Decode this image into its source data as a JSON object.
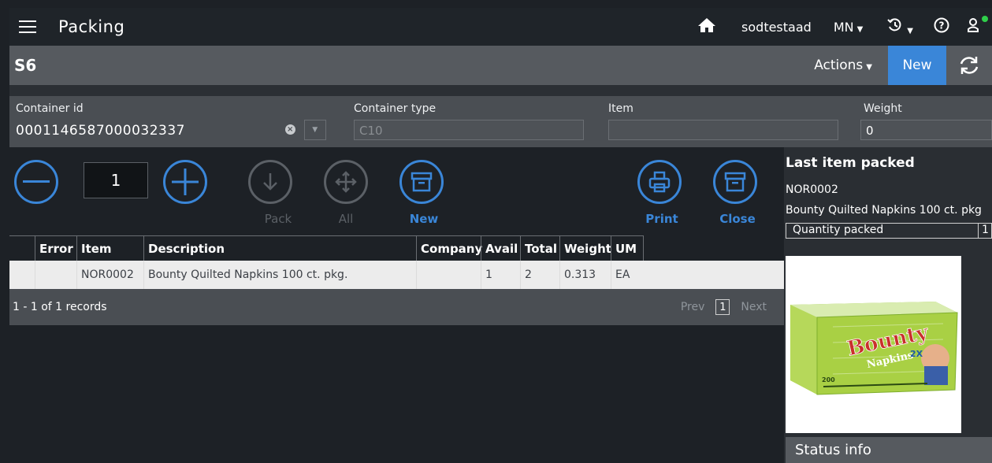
{
  "header": {
    "title": "Packing",
    "user": "sodtestaad",
    "lang": "MN"
  },
  "subheader": {
    "title": "S6",
    "actions_label": "Actions",
    "new_label": "New"
  },
  "fields": {
    "container_id": {
      "label": "Container id",
      "value": "0001146587000032337"
    },
    "container_type": {
      "label": "Container type",
      "value": "C10"
    },
    "item": {
      "label": "Item",
      "value": ""
    },
    "weight": {
      "label": "Weight",
      "value": "0"
    }
  },
  "toolbar": {
    "quantity": "1",
    "pack_label": "Pack",
    "all_label": "All",
    "new_label": "New",
    "print_label": "Print",
    "close_label": "Close"
  },
  "table": {
    "headers": [
      "Error",
      "Item",
      "Description",
      "Company",
      "Avail",
      "Total",
      "Weight",
      "UM"
    ],
    "rows": [
      {
        "error": "",
        "item": "NOR0002",
        "description": "Bounty Quilted Napkins 100 ct. pkg.",
        "company": "",
        "avail": "1",
        "total": "2",
        "weight": "0.313",
        "um": "EA"
      }
    ],
    "records": "1 - 1 of 1 records",
    "prev": "Prev",
    "page": "1",
    "next": "Next"
  },
  "side": {
    "title": "Last item packed",
    "item_code": "NOR0002",
    "item_desc": "Bounty Quilted Napkins 100 ct. pkg",
    "qty_label": "Quantity packed",
    "qty_value": "1",
    "status_title": "Status info",
    "product": {
      "brand": "Bounty",
      "product": "Napkins",
      "count": "200",
      "badge": "2X"
    }
  },
  "colors": {
    "accent": "#3a86d8",
    "online": "#2fcf4a"
  },
  "icons": [
    "menu-icon",
    "home-icon",
    "history-icon",
    "help-icon",
    "user-icon",
    "refresh-icon",
    "minus-icon",
    "plus-icon",
    "pack-arrow-icon",
    "move-all-icon",
    "box-icon",
    "print-icon",
    "close-box-icon",
    "clear-icon",
    "chevron-down-icon"
  ]
}
